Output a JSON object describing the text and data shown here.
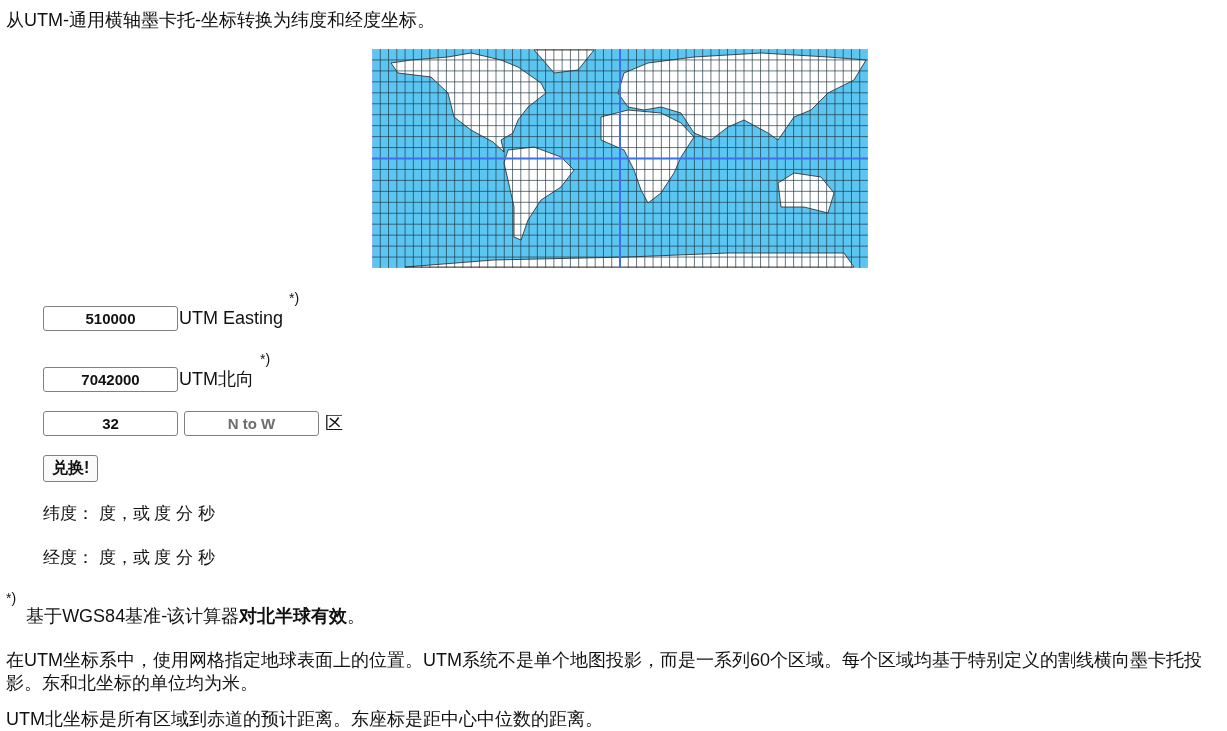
{
  "title": "从UTM-通用横轴墨卡托-坐标转换为纬度和经度坐标。",
  "form": {
    "fields": [
      {
        "value": "510000",
        "label": "UTM Easting",
        "footnote_mark": "*)"
      },
      {
        "value": "7042000",
        "label": "UTM北向",
        "footnote_mark": "*)"
      }
    ],
    "zone": {
      "number": "32",
      "hemisphere": {
        "value": "N to W",
        "disabled": true
      },
      "label": "区"
    },
    "convert_button": "兑换!",
    "results": [
      "纬度： 度，或 度 分 秒",
      "经度： 度，或 度 分 秒"
    ]
  },
  "footnote": {
    "mark": "*)",
    "text": "基于WGS84基准-该计算器**对北半球有效**。"
  },
  "paragraphs": [
    "在UTM坐标系中，使用网格指定地球表面上的位置。UTM系统不是单个地图投影，而是一系列60个区域。每个区域均基于特别定义的割线横向墨卡托投影。东和北坐标的单位均为米。",
    "UTM北坐标是所有区域到赤道的预计距离。东座标是距中心中位数的距离。"
  ]
}
